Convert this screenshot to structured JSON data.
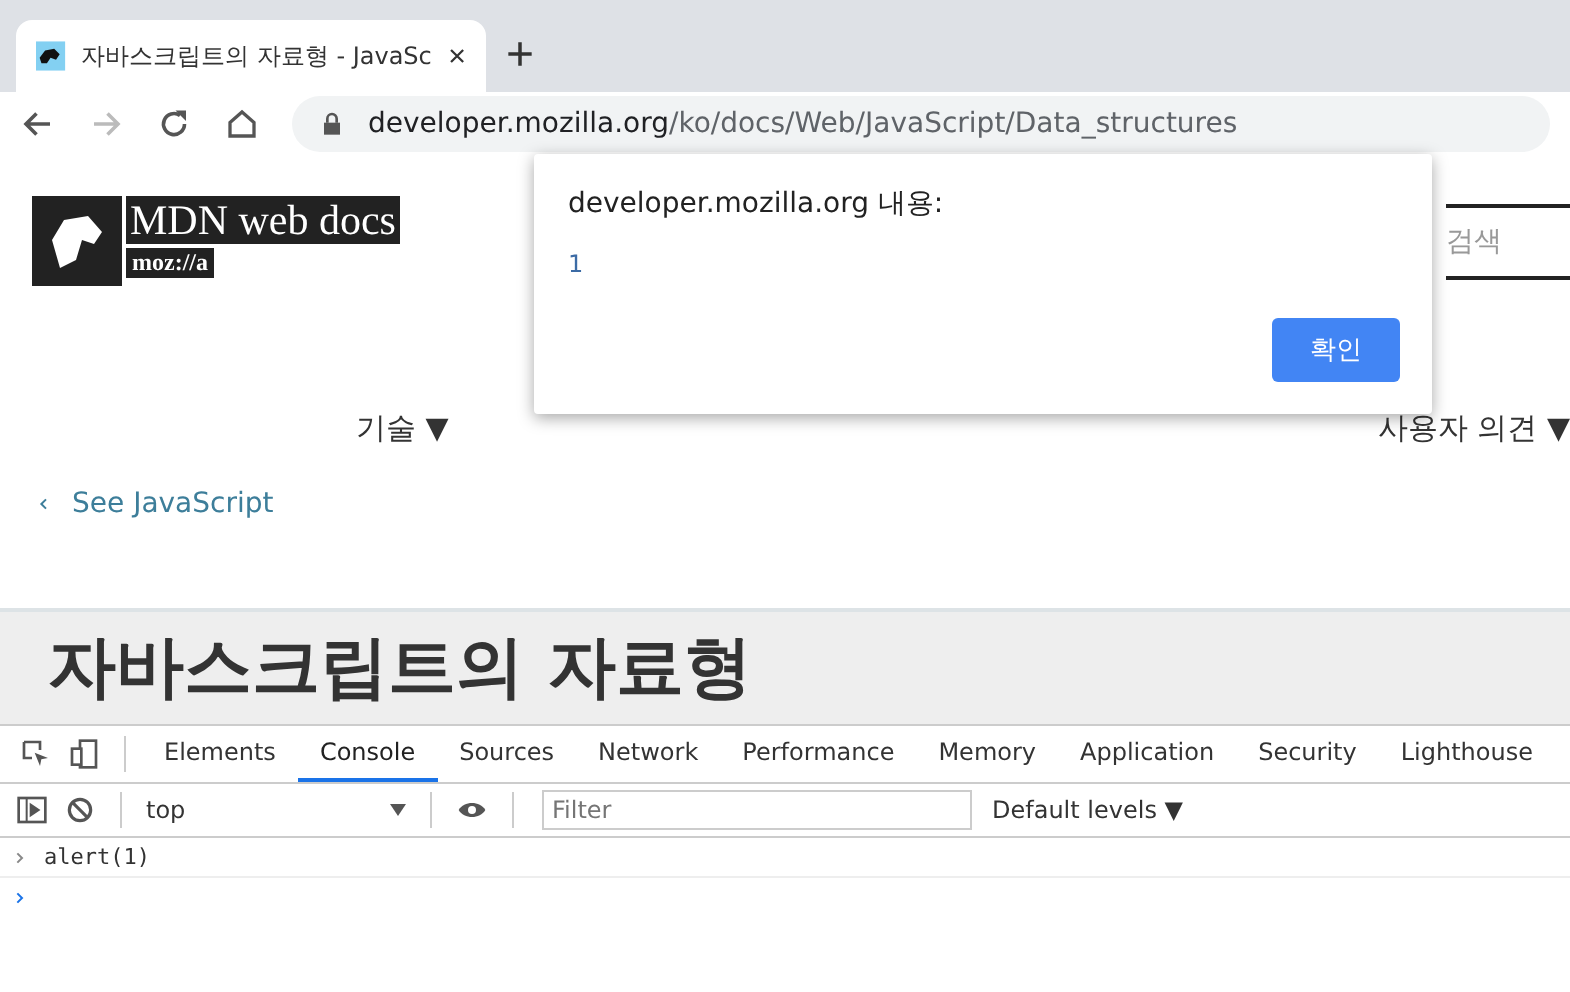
{
  "browser": {
    "tab": {
      "title": "자바스크립트의 자료형 - JavaSc"
    },
    "url": {
      "host": "developer.mozilla.org",
      "path": "/ko/docs/Web/JavaScript/Data_structures"
    }
  },
  "page": {
    "logo": {
      "title": "MDN web docs",
      "subtitle": "moz://a"
    },
    "search": {
      "placeholder": "검색"
    },
    "nav": [
      "기술 ▼",
      "사용자 의견 ▼"
    ],
    "back_link": "See JavaScript",
    "heading": "자바스크립트의 자료형"
  },
  "dialog": {
    "title": "developer.mozilla.org 내용:",
    "message": "1",
    "button": "확인"
  },
  "devtools": {
    "tabs": [
      {
        "label": "Elements",
        "selected": false
      },
      {
        "label": "Console",
        "selected": true
      },
      {
        "label": "Sources",
        "selected": false
      },
      {
        "label": "Network",
        "selected": false
      },
      {
        "label": "Performance",
        "selected": false
      },
      {
        "label": "Memory",
        "selected": false
      },
      {
        "label": "Application",
        "selected": false
      },
      {
        "label": "Security",
        "selected": false
      },
      {
        "label": "Lighthouse",
        "selected": false
      }
    ],
    "context": "top",
    "filter": {
      "placeholder": "Filter"
    },
    "levels": "Default levels ▼",
    "console_lines": [
      "alert(1)"
    ]
  }
}
